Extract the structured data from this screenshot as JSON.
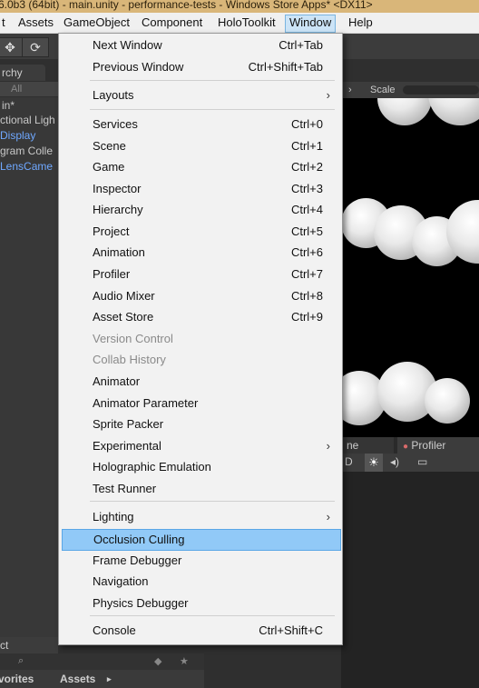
{
  "titlebar": {
    "text": "6.0b3 (64bit) - main.unity - performance-tests - Windows Store Apps* <DX11>"
  },
  "menubar": {
    "items": [
      "t",
      "Assets",
      "GameObject",
      "Component",
      "HoloToolkit",
      "Window",
      "Help"
    ],
    "active": "Window"
  },
  "hierarchy": {
    "tab": "rchy",
    "search": "All",
    "rows": [
      "in*",
      "ctional Ligh",
      "Display",
      "gram Colle",
      "LensCame"
    ]
  },
  "project": {
    "tab": "ct",
    "favorites": "vorites",
    "assets": "Assets"
  },
  "scene": {
    "scale_label": "Scale"
  },
  "lower_panel": {
    "tab_scene": "ne",
    "tab_profiler": "Profiler",
    "mode": "D"
  },
  "window_menu": {
    "items": [
      {
        "label": "Next Window",
        "shortcut": "Ctrl+Tab"
      },
      {
        "label": "Previous Window",
        "shortcut": "Ctrl+Shift+Tab"
      },
      {
        "label": "Layouts",
        "submenu": true
      },
      {
        "label": "Services",
        "shortcut": "Ctrl+0"
      },
      {
        "label": "Scene",
        "shortcut": "Ctrl+1"
      },
      {
        "label": "Game",
        "shortcut": "Ctrl+2"
      },
      {
        "label": "Inspector",
        "shortcut": "Ctrl+3"
      },
      {
        "label": "Hierarchy",
        "shortcut": "Ctrl+4"
      },
      {
        "label": "Project",
        "shortcut": "Ctrl+5"
      },
      {
        "label": "Animation",
        "shortcut": "Ctrl+6"
      },
      {
        "label": "Profiler",
        "shortcut": "Ctrl+7"
      },
      {
        "label": "Audio Mixer",
        "shortcut": "Ctrl+8"
      },
      {
        "label": "Asset Store",
        "shortcut": "Ctrl+9"
      },
      {
        "label": "Version Control",
        "disabled": true
      },
      {
        "label": "Collab History",
        "disabled": true
      },
      {
        "label": "Animator"
      },
      {
        "label": "Animator Parameter"
      },
      {
        "label": "Sprite Packer"
      },
      {
        "label": "Experimental",
        "submenu": true
      },
      {
        "label": "Holographic Emulation"
      },
      {
        "label": "Test Runner"
      },
      {
        "label": "Lighting",
        "submenu": true
      },
      {
        "label": "Occlusion Culling",
        "highlighted": true
      },
      {
        "label": "Frame Debugger"
      },
      {
        "label": "Navigation"
      },
      {
        "label": "Physics Debugger"
      },
      {
        "label": "Console",
        "shortcut": "Ctrl+Shift+C"
      }
    ]
  },
  "colors": {
    "highlight": "#91c9f7",
    "titlebar": "#d9b679",
    "menu_bg": "#f2f2f2"
  },
  "icons": [
    "move-tool-icon",
    "rotate-tool-icon",
    "submenu-arrow-icon",
    "search-icon",
    "light-icon",
    "audio-icon",
    "image-icon",
    "lock-icon",
    "star-icon"
  ]
}
